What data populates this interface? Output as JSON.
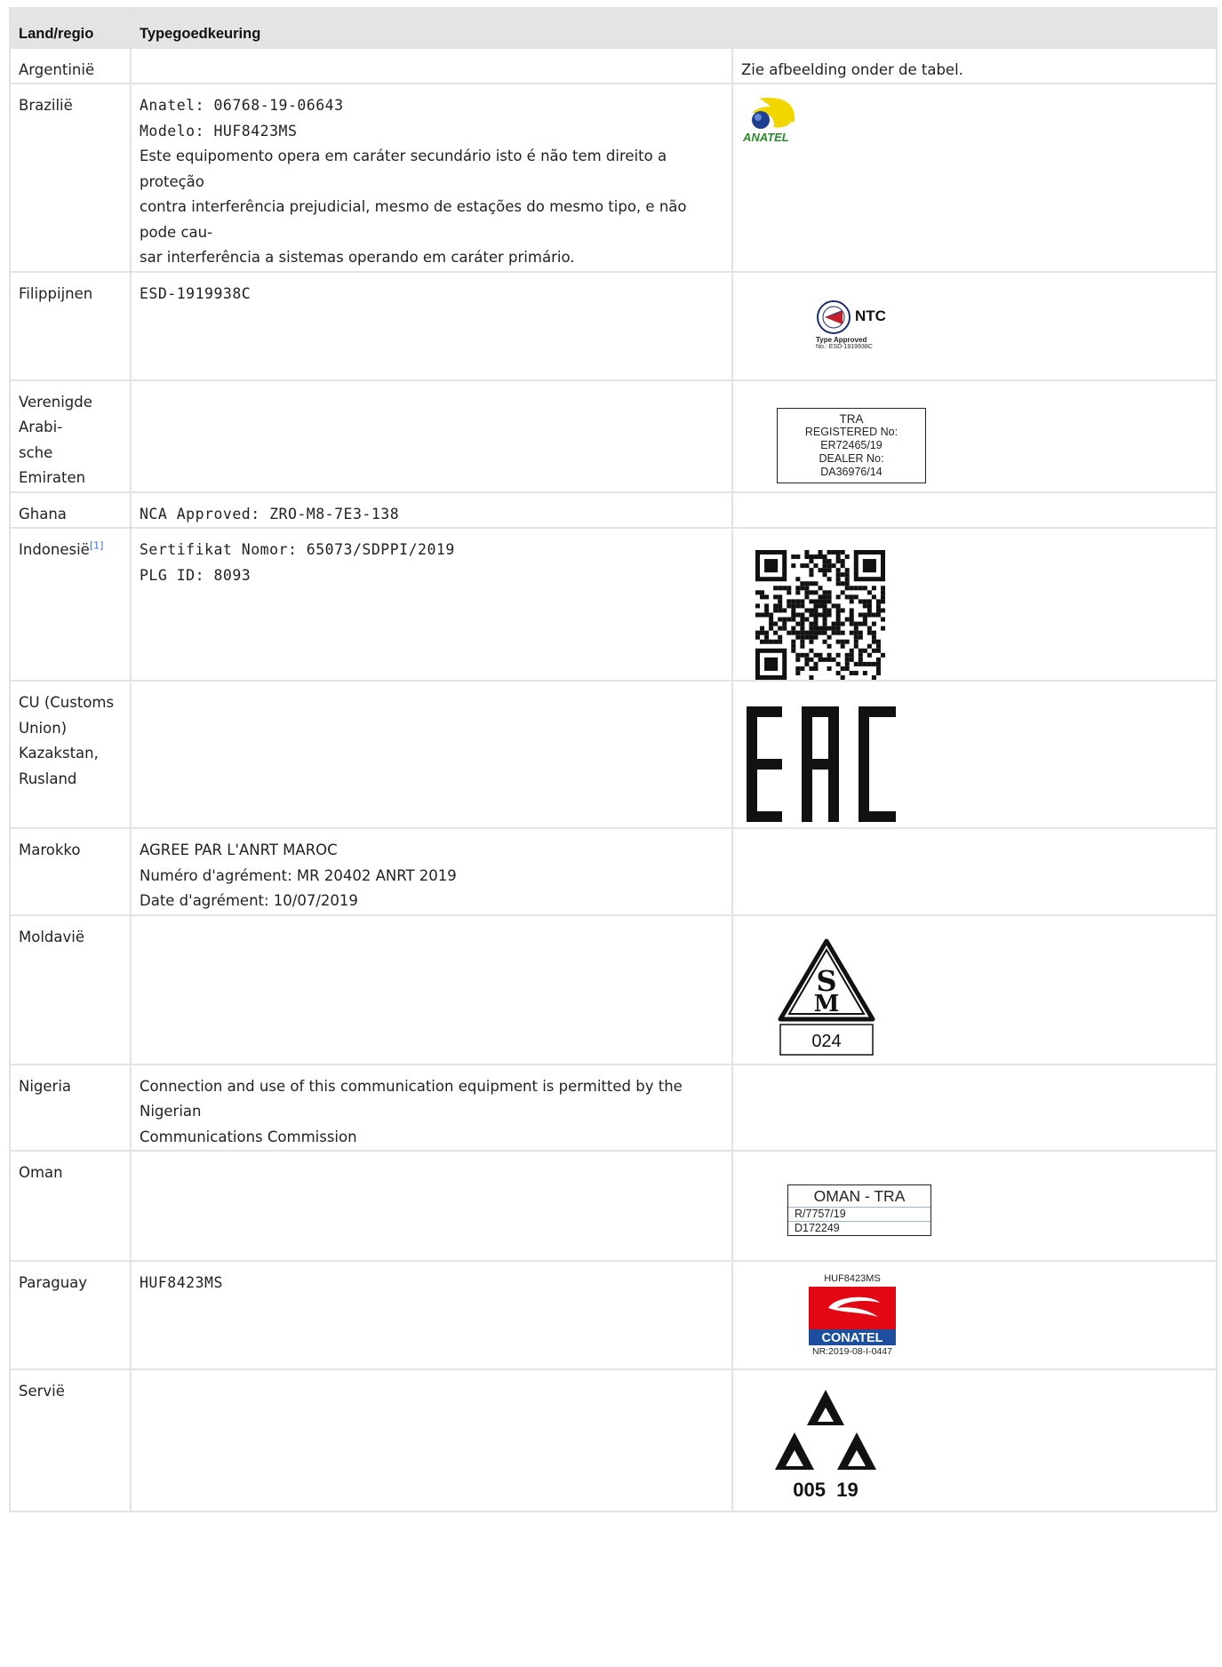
{
  "table": {
    "header": {
      "col1": "Land/regio",
      "col2": "Typegoedkeuring"
    },
    "rows": {
      "argentinie": {
        "country": "Argentinië",
        "note": "Zie afbeelding onder de tabel."
      },
      "brazilie": {
        "country": "Brazilië",
        "lines": [
          "Anatel: 06768-19-06643",
          "Modelo: HUF8423MS",
          "Este equipomento opera em caráter secundário isto é não tem direito a proteção",
          "contra interferência prejudicial, mesmo de estações do mesmo tipo, e não pode cau-",
          "sar interferência a sistemas operando em caráter primário."
        ],
        "logo_text": "ANATEL"
      },
      "filippijnen": {
        "country": "Filippijnen",
        "code": "ESD-1919938C",
        "logo": {
          "title": "NTC",
          "approved": "Type Approved",
          "no": "No.: ESD-1919938C"
        }
      },
      "vae": {
        "country_lines": [
          "Verenigde Arabi-",
          "sche Emiraten"
        ],
        "label_lines": [
          "TRA",
          "REGISTERED No:",
          "ER72465/19",
          "DEALER No:",
          "DA36976/14"
        ]
      },
      "ghana": {
        "country": "Ghana",
        "code": "NCA Approved: ZRO-M8-7E3-138"
      },
      "indonesie": {
        "country": "Indonesië",
        "ref": "[1]",
        "lines": [
          "Sertifikat Nomor: 65073/SDPPI/2019",
          "PLG ID: 8093"
        ]
      },
      "cu": {
        "country_lines": [
          "CU (Customs",
          "Union)",
          "Kazakstan,",
          "Rusland"
        ],
        "logo_text": "EAC"
      },
      "marokko": {
        "country": "Marokko",
        "lines": [
          "AGREE PAR L'ANRT MAROC",
          "Numéro d'agrément: MR 20402 ANRT 2019",
          "Date d'agrément: 10/07/2019"
        ]
      },
      "moldavie": {
        "country": "Moldavië",
        "logo_number": "024"
      },
      "nigeria": {
        "country": "Nigeria",
        "lines": [
          "Connection and use of this communication equipment is permitted by the Nigerian",
          "Communications Commission"
        ]
      },
      "oman": {
        "country": "Oman",
        "label_title": "OMAN - TRA",
        "label_rows": [
          "R/7757/19",
          "D172249"
        ]
      },
      "paraguay": {
        "country": "Paraguay",
        "code": "HUF8423MS",
        "logo": {
          "model": "HUF8423MS",
          "name": "CONATEL",
          "nr": "NR:2019-08-I-0447"
        }
      },
      "servie": {
        "country": "Servië",
        "logo_number": "005  19"
      }
    }
  },
  "colors": {
    "header_bg": "#e4e4e4",
    "grid": "#e3e3e3",
    "anatel_yellow": "#f2d600",
    "anatel_blue": "#1d3f8f",
    "anatel_green": "#2a8a2a",
    "conatel_red": "#e30613",
    "conatel_blue": "#1d4f9e",
    "ref_link": "#3b6fd1"
  }
}
